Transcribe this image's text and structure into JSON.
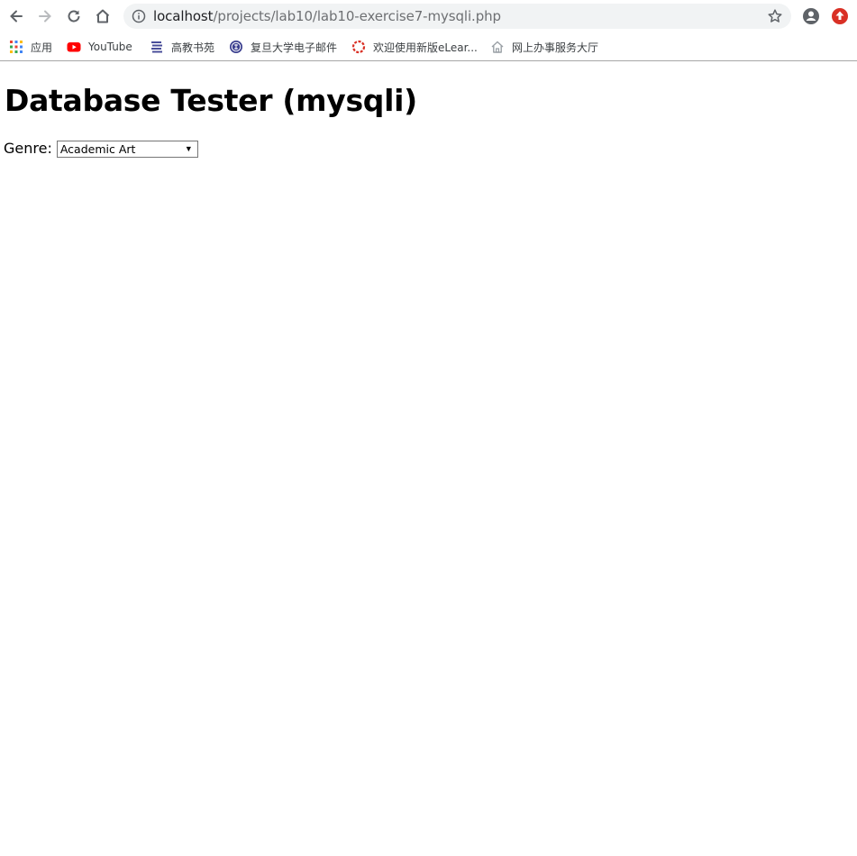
{
  "browser": {
    "url_host": "localhost",
    "url_path": "/projects/lab10/lab10-exercise7-mysqli.php",
    "update_color": "#d93025"
  },
  "bookmarks": [
    {
      "label": "应用",
      "icon": "apps-grid-icon"
    },
    {
      "label": "YouTube",
      "icon": "youtube-icon",
      "color": "#ff0000"
    },
    {
      "label": "高教书苑",
      "icon": "book-stack-icon"
    },
    {
      "label": "复旦大学电子邮件",
      "icon": "fudan-seal-icon"
    },
    {
      "label": "欢迎使用新版eLear...",
      "icon": "elearning-ring-icon",
      "color": "#d93025"
    },
    {
      "label": "网上办事服务大厅",
      "icon": "house-icon"
    }
  ],
  "page": {
    "title": "Database Tester (mysqli)",
    "genre_label": "Genre:",
    "genre_selected": "Academic Art"
  }
}
